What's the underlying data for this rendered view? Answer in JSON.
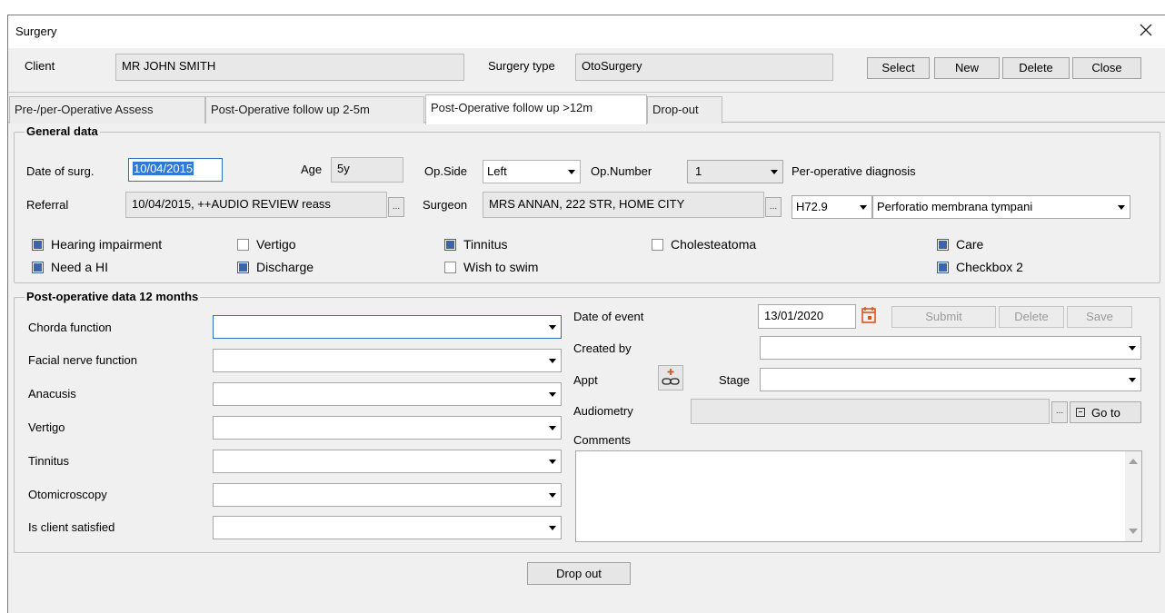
{
  "window": {
    "title": "Surgery"
  },
  "header": {
    "client_label": "Client",
    "client_value": "MR JOHN SMITH",
    "surgery_type_label": "Surgery type",
    "surgery_type_value": "OtoSurgery",
    "buttons": {
      "select": "Select",
      "new": "New",
      "delete": "Delete",
      "close": "Close"
    }
  },
  "tabs": [
    {
      "label": "Pre-/per-Operative Assess",
      "active": false
    },
    {
      "label": "Post-Operative follow up 2-5m",
      "active": false
    },
    {
      "label": "Post-Operative follow up >12m",
      "active": true
    },
    {
      "label": "Drop-out",
      "active": false
    }
  ],
  "general": {
    "title": "General data",
    "date_label": "Date of surg.",
    "date_value": "10/04/2015",
    "age_label": "Age",
    "age_value": "5y",
    "opside_label": "Op.Side",
    "opside_value": "Left",
    "opnumber_label": "Op.Number",
    "opnumber_value": "1",
    "perop_diag_label": "Per-operative diagnosis",
    "referral_label": "Referral",
    "referral_value": "10/04/2015, ++AUDIO REVIEW reass",
    "surgeon_label": "Surgeon",
    "surgeon_value": "MRS ANNAN, 222 STR, HOME CITY",
    "diag_code": "H72.9",
    "diag_text": "Perforatio membrana tympani",
    "browse_label": "...",
    "checkboxes": [
      {
        "label": "Hearing impairment",
        "checked": true
      },
      {
        "label": "Vertigo",
        "checked": false
      },
      {
        "label": "Tinnitus",
        "checked": true
      },
      {
        "label": "Cholesteatoma",
        "checked": false
      },
      {
        "label": "Care",
        "checked": true
      },
      {
        "label": "Need a HI",
        "checked": true
      },
      {
        "label": "Discharge",
        "checked": true
      },
      {
        "label": "Wish to swim",
        "checked": false
      },
      {
        "label": "Checkbox 2",
        "checked": true
      }
    ]
  },
  "post": {
    "title": "Post-operative data 12 months",
    "fields": [
      {
        "label": "Chorda function",
        "value": ""
      },
      {
        "label": "Facial nerve function",
        "value": ""
      },
      {
        "label": "Anacusis",
        "value": ""
      },
      {
        "label": "Vertigo",
        "value": ""
      },
      {
        "label": "Tinnitus",
        "value": ""
      },
      {
        "label": "Otomicroscopy",
        "value": ""
      },
      {
        "label": "Is client satisfied",
        "value": ""
      }
    ],
    "date_event_label": "Date of event",
    "date_event_value": "13/01/2020",
    "submit_label": "Submit",
    "delete_label": "Delete",
    "save_label": "Save",
    "created_by_label": "Created by",
    "created_by_value": "",
    "appt_label": "Appt",
    "stage_label": "Stage",
    "stage_value": "",
    "audiometry_label": "Audiometry",
    "audiometry_value": "",
    "goto_label": "Go to",
    "comments_label": "Comments",
    "comments_value": ""
  },
  "footer": {
    "dropout_label": "Drop out"
  },
  "colors": {
    "check_fill": "#3c64a8",
    "calendar_icon": "#d9541e",
    "focus_select": "#3079d6"
  }
}
